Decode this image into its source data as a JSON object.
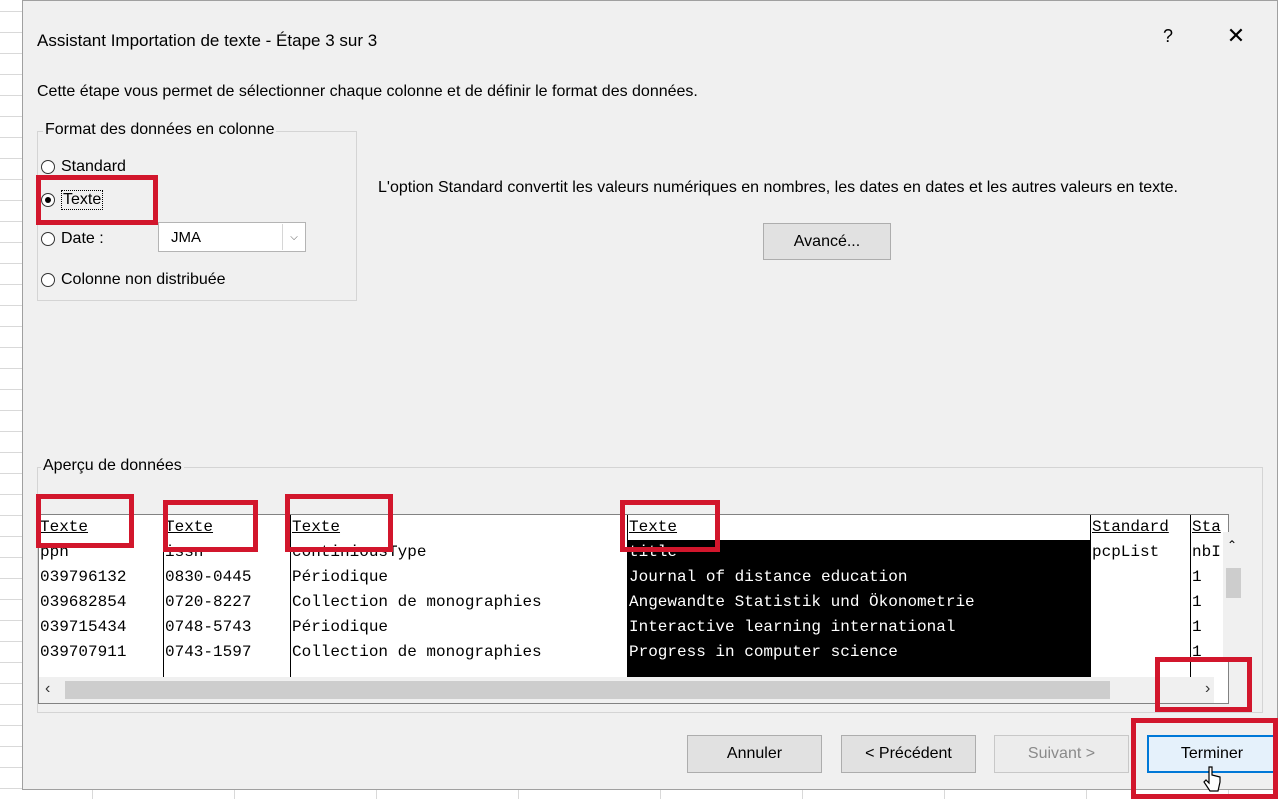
{
  "dialog": {
    "title": "Assistant Importation de texte - Étape 3 sur 3",
    "help_label": "?",
    "close_label": "✕",
    "intro": "Cette étape vous permet de sélectionner chaque colonne et de définir le format des données."
  },
  "format_group": {
    "legend": "Format des données en colonne",
    "options": [
      {
        "label": "Standard",
        "checked": false
      },
      {
        "label": "Texte",
        "checked": true
      },
      {
        "label": "Date :",
        "checked": false
      },
      {
        "label": "Colonne non distribuée",
        "checked": false
      }
    ],
    "date_format": "JMA"
  },
  "description": "L'option Standard convertit les valeurs numériques en nombres, les dates en dates et les autres valeurs en texte.",
  "advanced_button": "Avancé...",
  "preview": {
    "legend": "Aperçu de données",
    "columns": [
      {
        "header": "Texte",
        "cells": [
          "ppn",
          "039796132",
          "039682854",
          "039715434",
          "039707911"
        ],
        "selected": false
      },
      {
        "header": "Texte",
        "cells": [
          "issn",
          "0830-0445",
          "0720-8227",
          "0748-5743",
          "0743-1597"
        ],
        "selected": false
      },
      {
        "header": "Texte",
        "cells": [
          "continiousType",
          "Périodique",
          "Collection de monographies",
          "Périodique",
          "Collection de monographies"
        ],
        "selected": false
      },
      {
        "header": "Texte",
        "cells": [
          "title",
          "Journal of distance education",
          "Angewandte Statistik und Ökonometrie",
          "Interactive learning international",
          "Progress in computer science"
        ],
        "selected": true
      },
      {
        "header": "Standard",
        "cells": [
          "pcpList",
          "",
          "",
          "",
          ""
        ],
        "selected": false
      },
      {
        "header": "Sta",
        "cells": [
          "nbI",
          "1",
          "1",
          "1",
          "1"
        ],
        "selected": false
      }
    ]
  },
  "buttons": {
    "cancel": "Annuler",
    "previous": "< Précédent",
    "next": "Suivant >",
    "finish": "Terminer"
  },
  "colors": {
    "highlight_red": "#d2162c",
    "dialog_bg": "#f0f0f0",
    "primary_border": "#0078d7"
  }
}
